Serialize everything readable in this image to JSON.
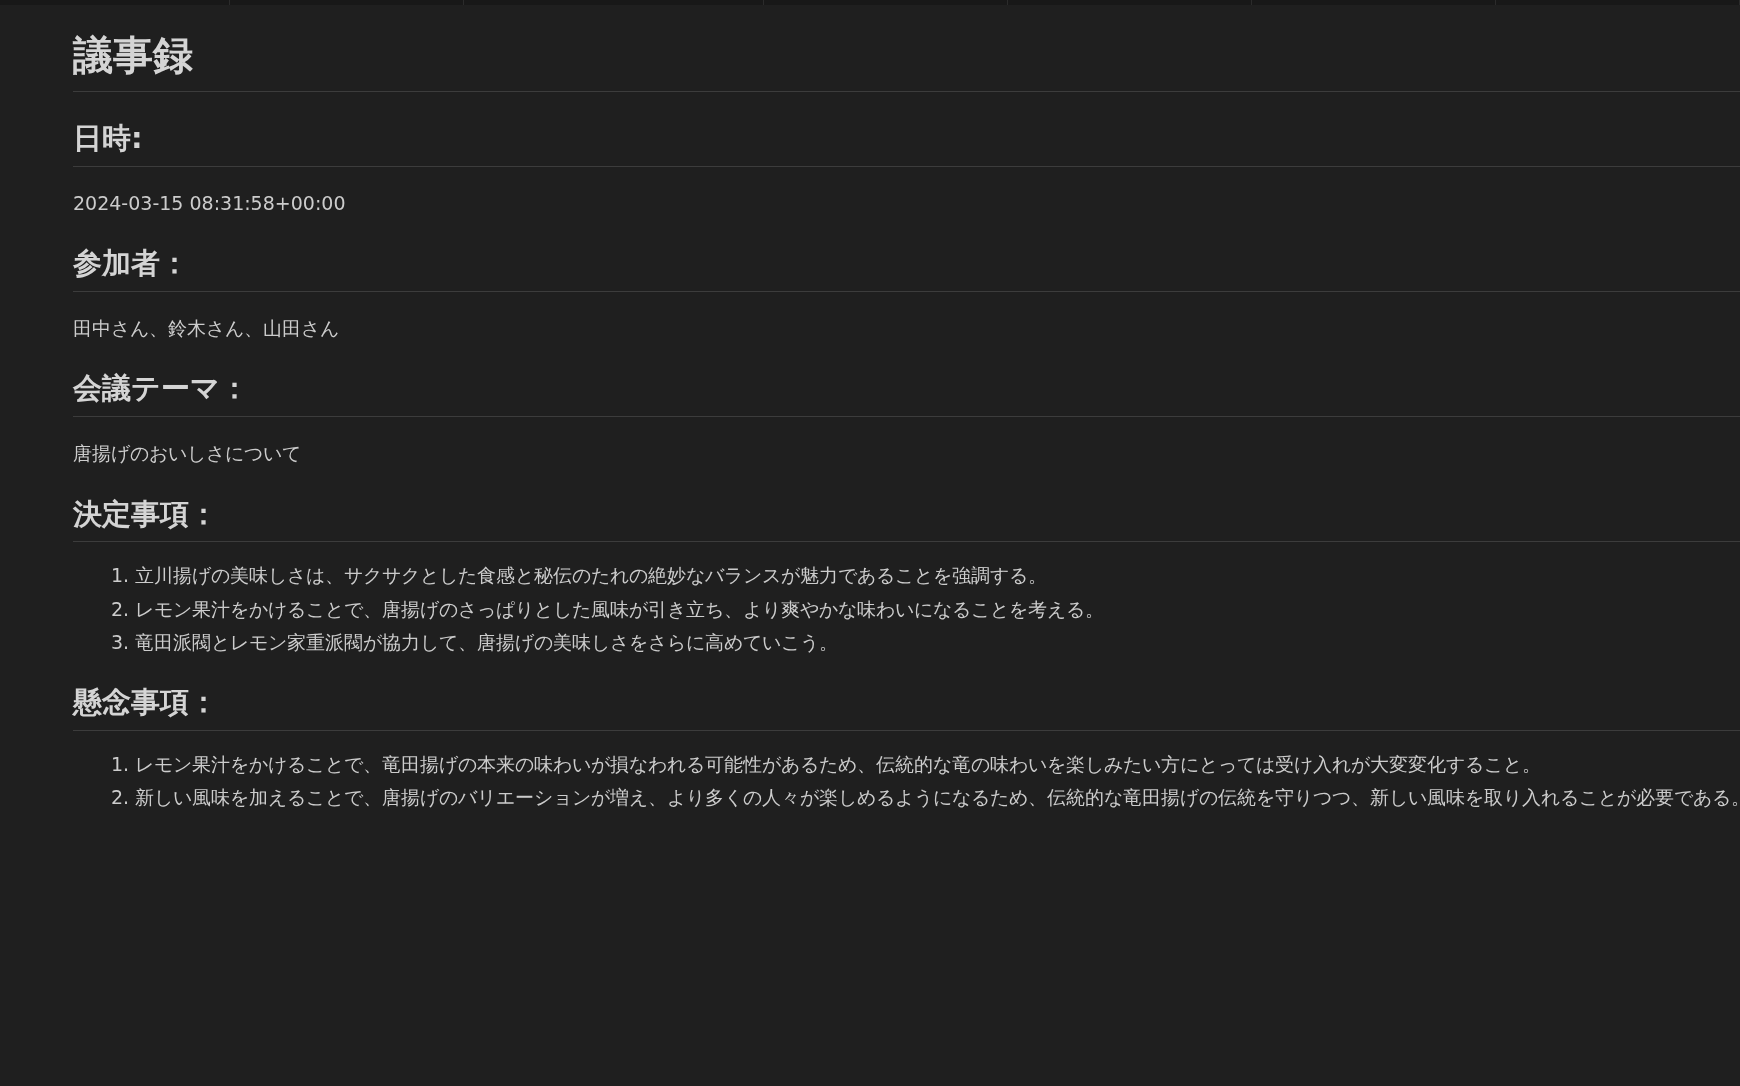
{
  "title": "議事録",
  "sections": [
    {
      "heading": "日時:",
      "kind": "paragraph",
      "text": "2024-03-15 08:31:58+00:00"
    },
    {
      "heading": "参加者：",
      "kind": "paragraph",
      "text": "田中さん、鈴木さん、山田さん"
    },
    {
      "heading": "会議テーマ：",
      "kind": "paragraph",
      "text": "唐揚げのおいしさについて"
    },
    {
      "heading": "決定事項：",
      "kind": "list",
      "items": [
        {
          "number": "1.",
          "text": "立川揚げの美味しさは、サクサクとした食感と秘伝のたれの絶妙なバランスが魅力であることを強調する。"
        },
        {
          "number": "2.",
          "text": "レモン果汁をかけることで、唐揚げのさっぱりとした風味が引き立ち、より爽やかな味わいになることを考える。"
        },
        {
          "number": "3.",
          "text": "竜田派閥とレモン家重派閥が協力して、唐揚げの美味しさをさらに高めていこう。"
        }
      ]
    },
    {
      "heading": "懸念事項：",
      "kind": "list",
      "items": [
        {
          "number": "1.",
          "text": "レモン果汁をかけることで、竜田揚げの本来の味わいが損なわれる可能性があるため、伝統的な竜の味わいを楽しみたい方にとっては受け入れが大変変化すること。"
        },
        {
          "number": "2.",
          "text": "新しい風味を加えることで、唐揚げのバリエーションが増え、より多くの人々が楽しめるようになるため、伝統的な竜田揚げの伝統を守りつつ、新しい風味を取り入れることが必要である。"
        }
      ]
    }
  ]
}
